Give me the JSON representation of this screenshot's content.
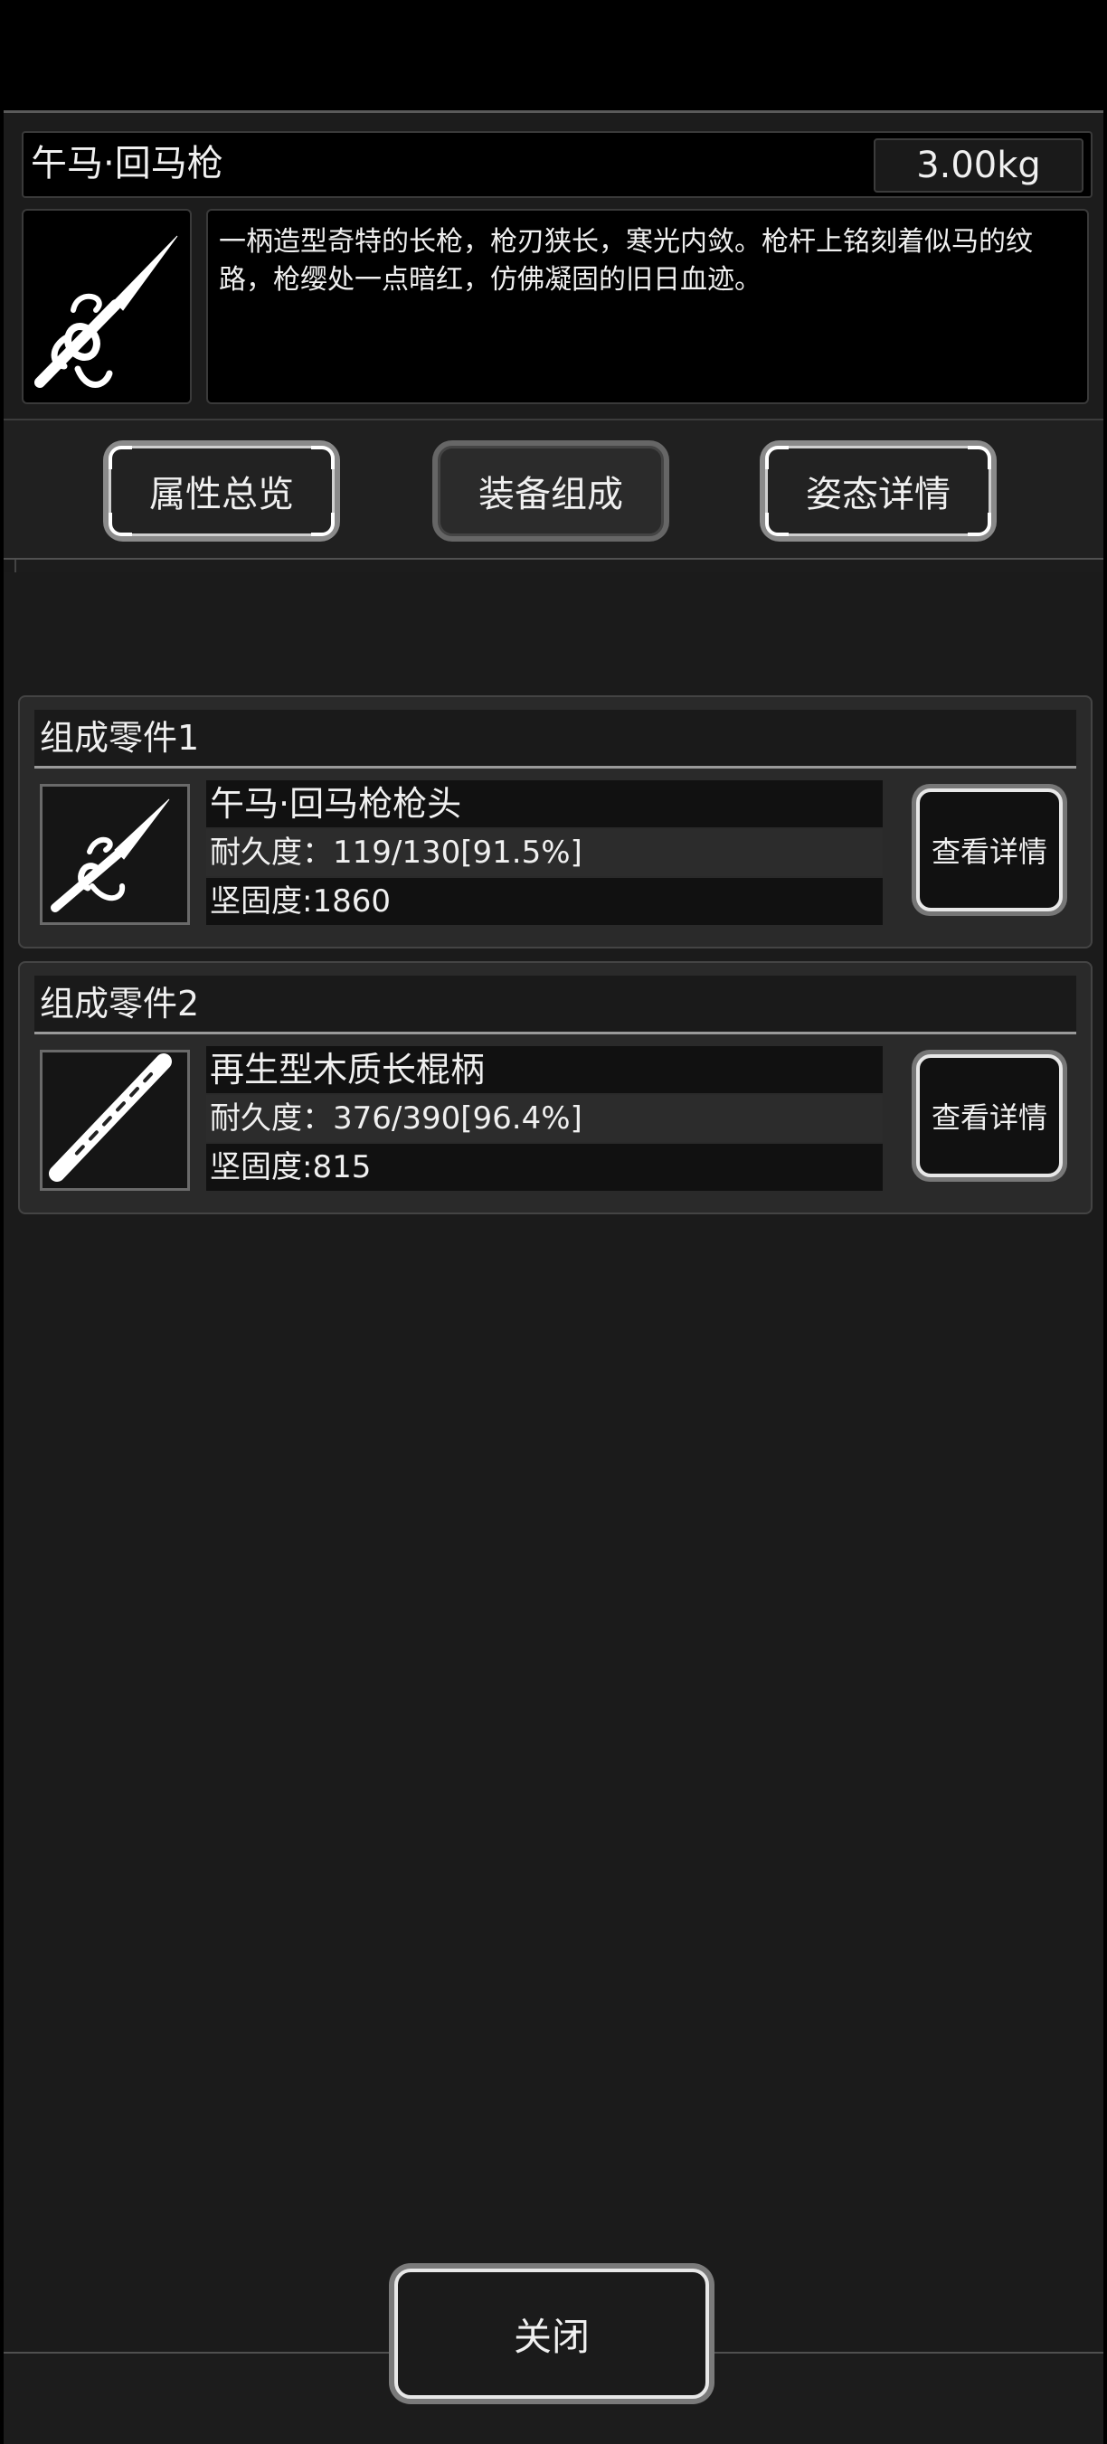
{
  "header": {
    "title": "午马·回马枪",
    "weight": "3.00kg",
    "item_icon": "spear-icon",
    "description": "一柄造型奇特的长枪，枪刃狭长，寒光内敛。枪杆上铭刻着似马的纹路，枪缨处一点暗红，仿佛凝固的旧日血迹。"
  },
  "tabs": [
    {
      "label": "属性总览",
      "active": false
    },
    {
      "label": "装备组成",
      "active": true
    },
    {
      "label": "姿态详情",
      "active": false
    }
  ],
  "parts": [
    {
      "heading": "组成零件1",
      "icon": "spearhead-icon",
      "name": "午马·回马枪枪头",
      "durability": "耐久度：119/130[91.5%]",
      "hardness": "坚固度:1860",
      "button": "查看详情"
    },
    {
      "heading": "组成零件2",
      "icon": "wooden-shaft-icon",
      "name": "再生型木质长棍柄",
      "durability": "耐久度：376/390[96.4%]",
      "hardness": "坚固度:815",
      "button": "查看详情"
    }
  ],
  "footer": {
    "close_label": "关闭"
  }
}
